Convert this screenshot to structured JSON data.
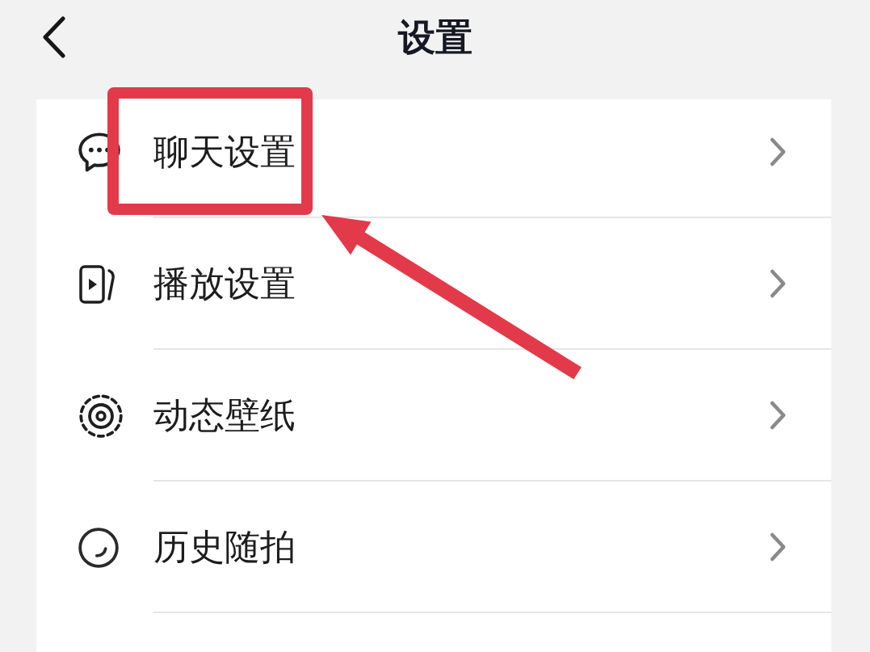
{
  "header": {
    "title": "设置"
  },
  "settings": [
    {
      "label": "聊天设置",
      "kind": "chat",
      "highlighted": true
    },
    {
      "label": "播放设置",
      "kind": "playback",
      "highlighted": false
    },
    {
      "label": "动态壁纸",
      "kind": "wallpaper",
      "highlighted": false
    },
    {
      "label": "历史随拍",
      "kind": "history",
      "highlighted": false
    }
  ]
}
